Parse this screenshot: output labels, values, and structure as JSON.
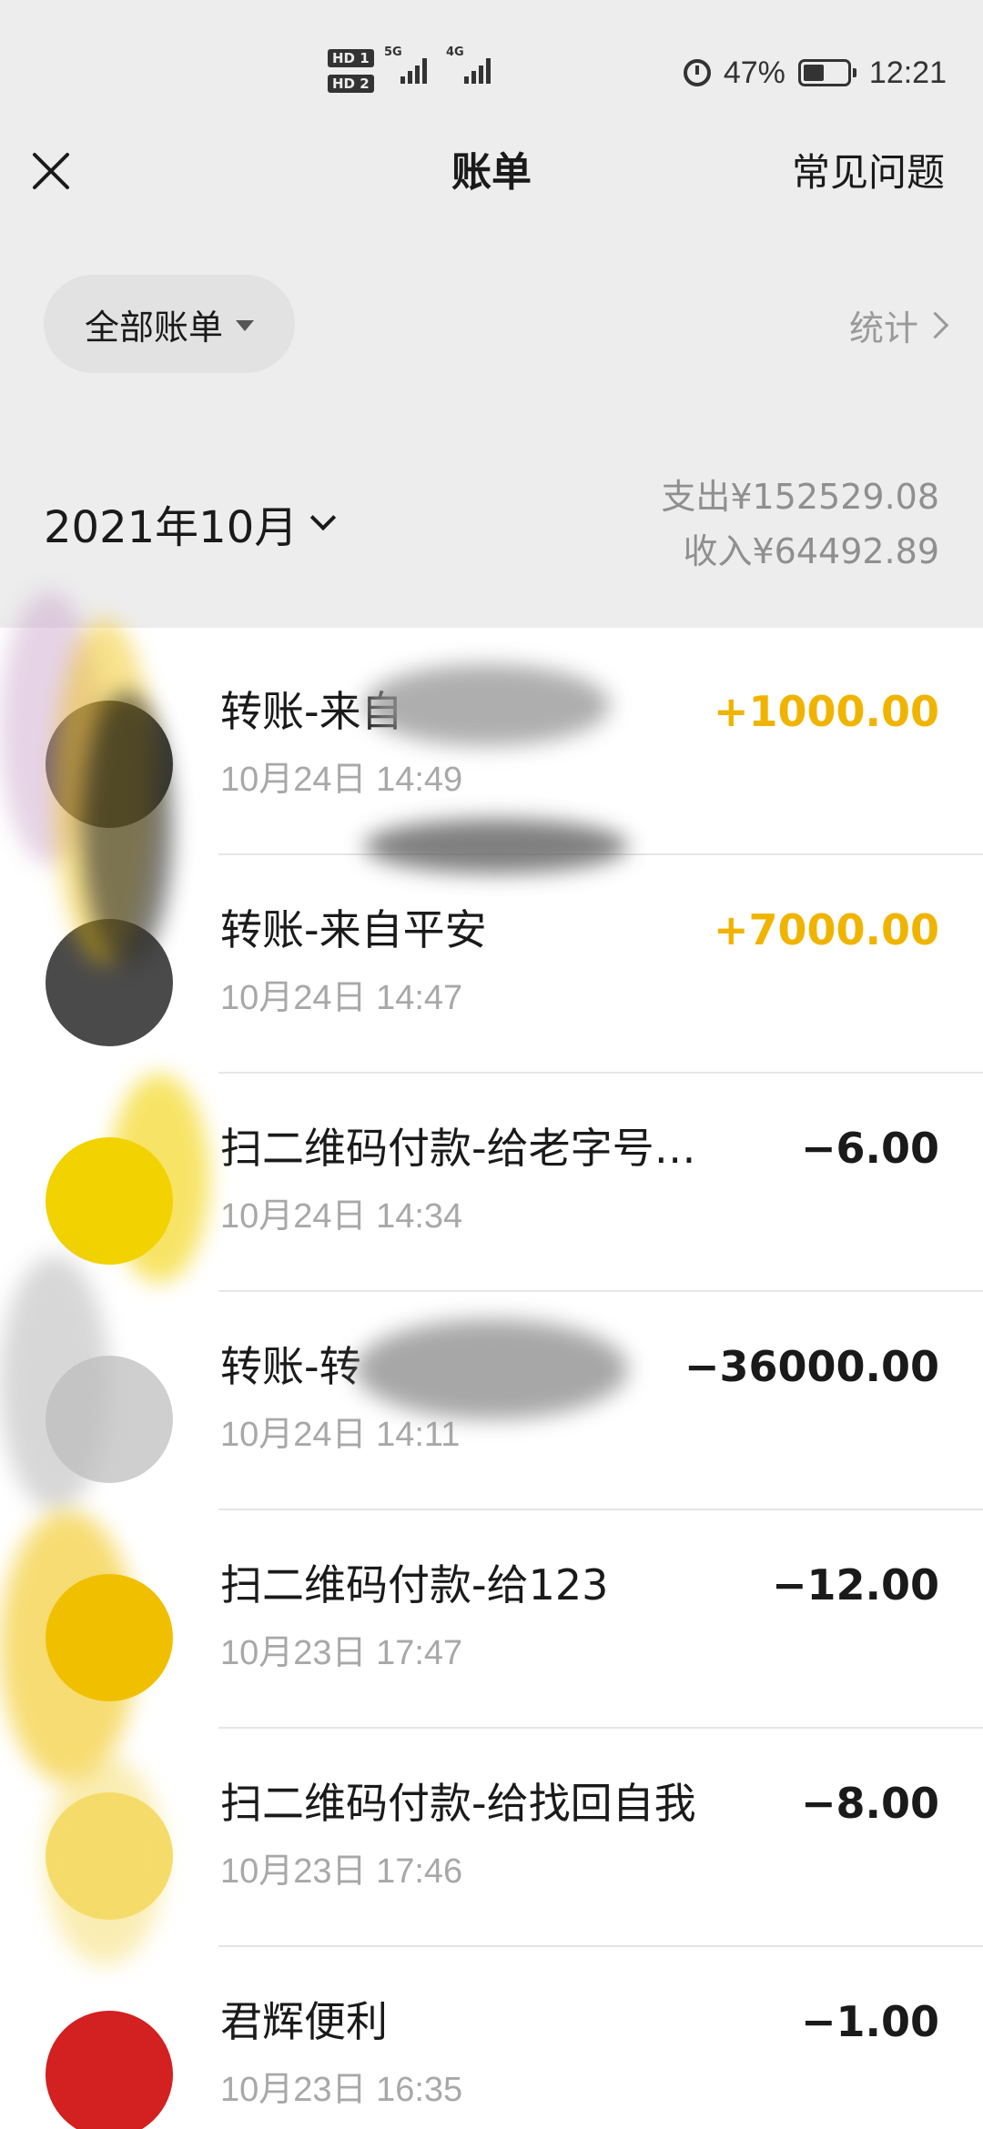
{
  "status_bar": {
    "hd1": "HD 1",
    "hd2": "HD 2",
    "net1": "5G",
    "net2": "4G",
    "battery_pct": "47%",
    "time": "12:21",
    "icons": [
      "alarm-icon",
      "battery-icon",
      "signal-icon"
    ]
  },
  "nav": {
    "title": "账单",
    "faq": "常见问题",
    "close_icon": "close-icon"
  },
  "filter": {
    "label": "全部账单",
    "stats": "统计"
  },
  "month": {
    "label": "2021年10月",
    "expense": "支出¥152529.08",
    "income": "收入¥64492.89"
  },
  "colors": {
    "income": "#f0b400",
    "header_bg": "#ededed",
    "muted_text": "#a8a8a8"
  },
  "transactions": [
    {
      "title": "转账-来自",
      "time": "10月24日 14:49",
      "amount": "+1000.00",
      "type": "income"
    },
    {
      "title": "转账-来自平安",
      "time": "10月24日 14:47",
      "amount": "+7000.00",
      "type": "income"
    },
    {
      "title": "扫二维码付款-给老字号…",
      "time": "10月24日 14:34",
      "amount": "−6.00",
      "type": "expense"
    },
    {
      "title": "转账-转",
      "time": "10月24日 14:11",
      "amount": "−36000.00",
      "type": "expense"
    },
    {
      "title": "扫二维码付款-给123",
      "time": "10月23日 17:47",
      "amount": "−12.00",
      "type": "expense"
    },
    {
      "title": "扫二维码付款-给找回自我",
      "time": "10月23日 17:46",
      "amount": "−8.00",
      "type": "expense"
    },
    {
      "title": "君辉便利",
      "time": "10月23日 16:35",
      "amount": "−1.00",
      "type": "expense"
    }
  ]
}
